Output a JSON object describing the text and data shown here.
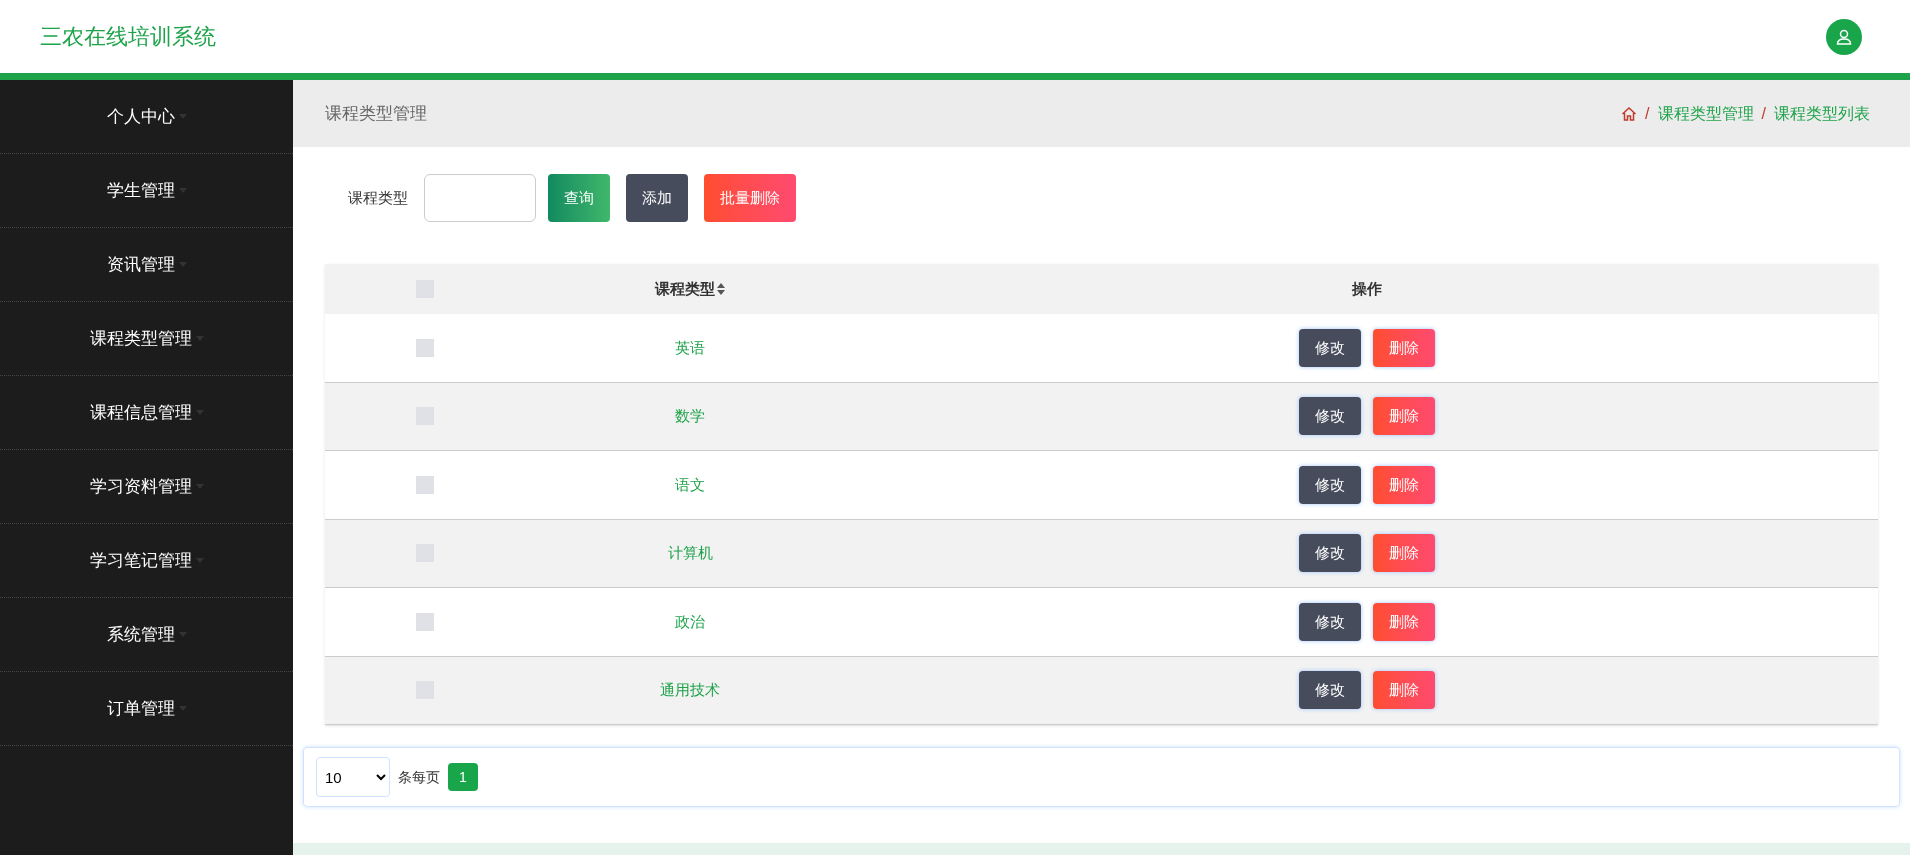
{
  "header": {
    "title": "三农在线培训系统"
  },
  "sidebar": {
    "items": [
      {
        "label": "个人中心"
      },
      {
        "label": "学生管理"
      },
      {
        "label": "资讯管理"
      },
      {
        "label": "课程类型管理"
      },
      {
        "label": "课程信息管理"
      },
      {
        "label": "学习资料管理"
      },
      {
        "label": "学习笔记管理"
      },
      {
        "label": "系统管理"
      },
      {
        "label": "订单管理"
      }
    ]
  },
  "page_title": "课程类型管理",
  "breadcrumb": {
    "separator": "/",
    "items": [
      "课程类型管理",
      "课程类型列表"
    ]
  },
  "search": {
    "label": "课程类型",
    "buttons": [
      {
        "label": "查询",
        "kind": "query"
      },
      {
        "label": "添加",
        "kind": "add"
      },
      {
        "label": "批量删除",
        "kind": "delete"
      }
    ]
  },
  "table": {
    "columns": [
      "课程类型",
      "操作"
    ],
    "all_checked": false,
    "rows": [
      {
        "checked": false,
        "name": "英语",
        "actions": [
          "修改",
          "删除"
        ]
      },
      {
        "checked": false,
        "name": "数学",
        "actions": [
          "修改",
          "删除"
        ]
      },
      {
        "checked": false,
        "name": "语文",
        "actions": [
          "修改",
          "删除"
        ]
      },
      {
        "checked": false,
        "name": "计算机",
        "actions": [
          "修改",
          "删除"
        ]
      },
      {
        "checked": false,
        "name": "政治",
        "actions": [
          "修改",
          "删除"
        ]
      },
      {
        "checked": false,
        "name": "通用技术",
        "actions": [
          "修改",
          "删除"
        ]
      }
    ]
  },
  "pagination": {
    "page_size": "10",
    "per_page_label": "条每页",
    "pages": [
      {
        "label": "1",
        "selected": true
      }
    ]
  }
}
